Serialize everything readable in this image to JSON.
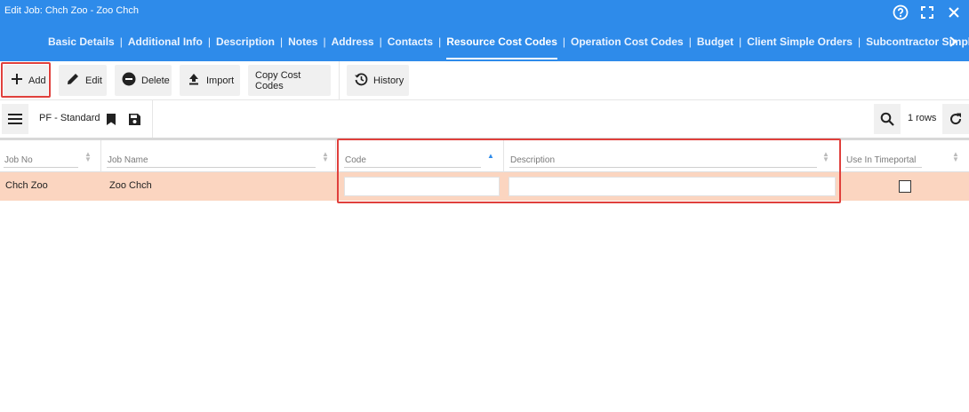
{
  "window": {
    "title": "Edit Job: Chch Zoo - Zoo Chch"
  },
  "tabs": [
    {
      "label": "Basic Details"
    },
    {
      "label": "Additional Info"
    },
    {
      "label": "Description"
    },
    {
      "label": "Notes"
    },
    {
      "label": "Address"
    },
    {
      "label": "Contacts"
    },
    {
      "label": "Resource Cost Codes",
      "active": true
    },
    {
      "label": "Operation Cost Codes"
    },
    {
      "label": "Budget"
    },
    {
      "label": "Client Simple Orders"
    },
    {
      "label": "Subcontractor Simpl"
    }
  ],
  "tab_separator": "|",
  "toolbar": {
    "add": "Add",
    "edit": "Edit",
    "delete": "Delete",
    "import": "Import",
    "copy_cost_codes": "Copy Cost Codes",
    "history": "History"
  },
  "view": {
    "name": "PF - Standard",
    "rows": "1 rows"
  },
  "grid": {
    "columns": [
      "Job No",
      "Job Name",
      "Code",
      "Description",
      "Use In Timeportal"
    ],
    "sorted_column": "Code",
    "rows": [
      {
        "job_no": "Chch Zoo",
        "job_name": "Zoo Chch",
        "code": "",
        "description": "",
        "use_in_timeportal": false
      }
    ]
  },
  "colors": {
    "header_bg": "#2e8bea",
    "selected_row_bg": "#fbd5c0",
    "highlight_border": "#e0403c"
  },
  "icons": [
    "help-icon",
    "fullscreen-icon",
    "close-icon",
    "chevron-right-icon",
    "plus-icon",
    "pencil-icon",
    "minus-circle-icon",
    "upload-icon",
    "history-icon",
    "menu-icon",
    "bookmark-icon",
    "save-icon",
    "search-icon",
    "refresh-icon"
  ]
}
